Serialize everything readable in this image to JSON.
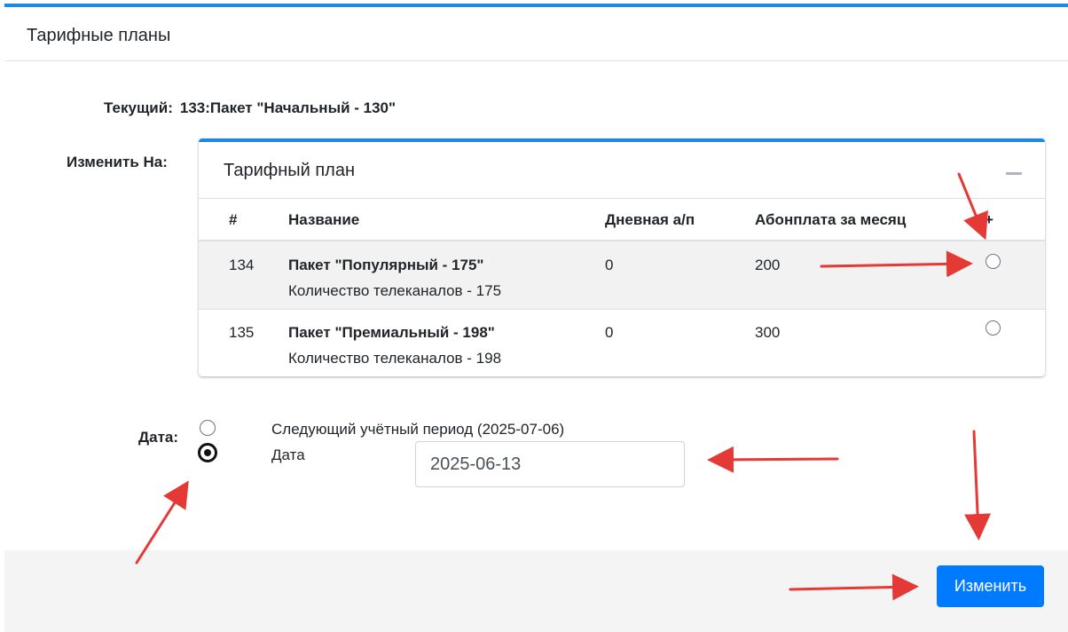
{
  "card": {
    "title": "Тарифные планы"
  },
  "current": {
    "label": "Текущий:",
    "value": "133:Пакет \"Начальный - 130\""
  },
  "change": {
    "label": "Изменить На:"
  },
  "plans_card": {
    "title": "Тарифный план",
    "columns": [
      "#",
      "Название",
      "Дневная а/п",
      "Абонплата за месяц",
      "+"
    ],
    "rows": [
      {
        "id": "134",
        "name": "Пакет \"Популярный - 175\"",
        "desc": "Количество телеканалов - 175",
        "daily": "0",
        "monthly": "200",
        "selected": false
      },
      {
        "id": "135",
        "name": "Пакет \"Премиальный - 198\"",
        "desc": "Количество телеканалов - 198",
        "daily": "0",
        "monthly": "300",
        "selected": false
      }
    ]
  },
  "date": {
    "label": "Дата:",
    "option_next_period": "Следующий учётный период (2025-07-06)",
    "option_date": "Дата",
    "date_value": "2025-06-13",
    "selected_option": "date"
  },
  "footer": {
    "submit_label": "Изменить"
  },
  "colors": {
    "accent": "#1e88e5",
    "primary_button": "#007bff",
    "annotation_arrow": "#e53935"
  }
}
